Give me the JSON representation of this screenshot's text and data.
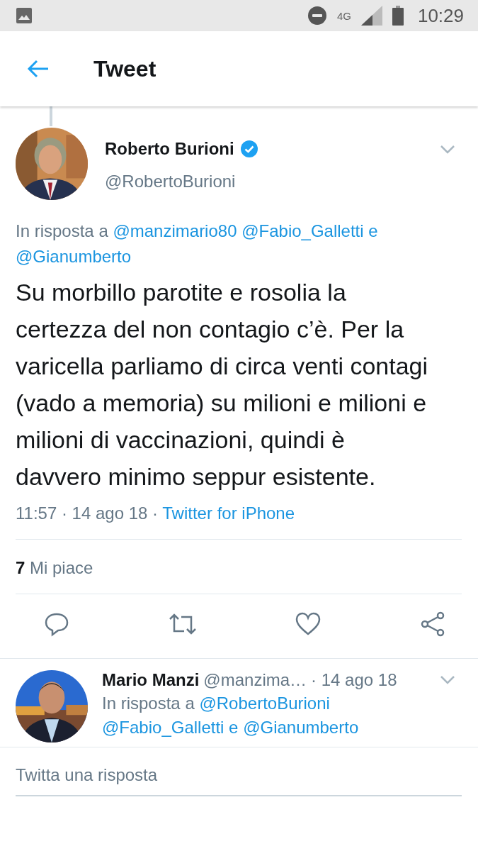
{
  "status_bar": {
    "network": "4G",
    "time": "10:29"
  },
  "header": {
    "title": "Tweet"
  },
  "tweet": {
    "author": "Roberto Burioni",
    "verified": true,
    "handle": "@RobertoBurioni",
    "reply_prefix": "In risposta a",
    "mentions": [
      "@manzimario80",
      "@Fabio_Galletti e",
      "@Gianumberto"
    ],
    "text": "Su morbillo parotite e rosolia la certezza del non contagio c’è. Per la varicella parliamo di circa venti contagi (vado a memoria) su milioni e milioni e milioni di vaccinazioni, quindi è davvero minimo seppur esistente.",
    "timestamp": "11:57 · 14 ago 18 ·",
    "source": "Twitter for iPhone",
    "likes_count": "7",
    "likes_label": "Mi piace",
    "actions": [
      {
        "kind": "reply"
      },
      {
        "kind": "retweet"
      },
      {
        "kind": "like"
      },
      {
        "kind": "share"
      }
    ]
  },
  "reply": {
    "author": "Mario Manzi",
    "handle": "@manzima…",
    "date": "· 14 ago 18",
    "reply_prefix": "In risposta a",
    "mentions": [
      "@RobertoBurioni",
      "@Fabio_Galletti e @Gianumberto"
    ]
  },
  "composer": {
    "placeholder": "Twitta una risposta"
  }
}
